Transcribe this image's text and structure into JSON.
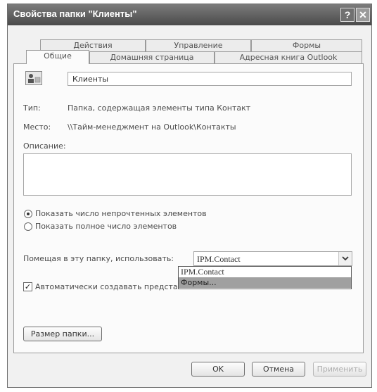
{
  "window": {
    "title": "Свойства папки \"Клиенты\"",
    "help_glyph": "?",
    "close_glyph": "✕"
  },
  "tabs": {
    "back_row": [
      "Действия",
      "Управление",
      "Формы"
    ],
    "front_row": [
      "Общие",
      "Домашняя страница",
      "Адресная книга Outlook"
    ],
    "active": "Общие"
  },
  "general": {
    "folder_name": "Клиенты",
    "type_label": "Тип:",
    "type_value": "Папка, содержащая элементы типа Контакт",
    "location_label": "Место:",
    "location_value": "\\\\Тайм-менеджмент на Outlook\\Контакты",
    "description_label": "Описание:",
    "description_value": "",
    "radio_unread": "Показать число непрочтенных элементов",
    "radio_total": "Показать полное число элементов",
    "radio_selected": "unread",
    "post_label": "Помещая в эту папку, использовать:",
    "post_value": "IPM.Contact",
    "dropdown_options": [
      "IPM.Contact",
      "Формы..."
    ],
    "dropdown_highlighted": "Формы...",
    "auto_checkbox_label": "Автоматически создавать представ",
    "auto_checkbox_checked": true,
    "folder_size_button": "Размер папки..."
  },
  "footer": {
    "ok": "OK",
    "cancel": "Отмена",
    "apply": "Применить"
  },
  "colors": {
    "titlebar": "#5a5a5a",
    "dropdown_highlight": "#9c9c9c"
  }
}
